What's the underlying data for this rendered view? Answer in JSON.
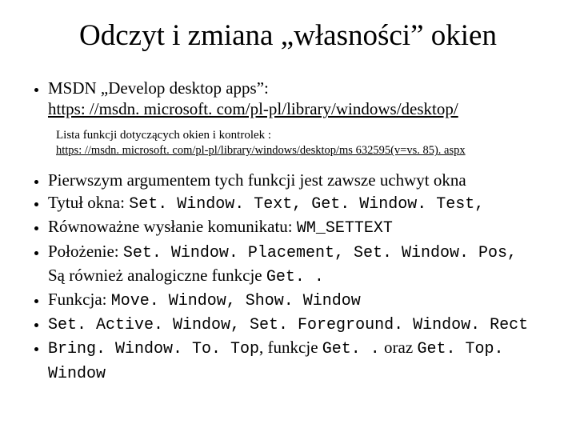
{
  "title": "Odczyt i zmiana „własności” okien",
  "intro": {
    "line1": "MSDN „Develop desktop apps”:",
    "url1": "https: //msdn. microsoft. com/pl-pl/library/windows/desktop/"
  },
  "sub": {
    "line1": "Lista funkcji dotyczących okien i kontrolek :",
    "url1": "https: //msdn. microsoft. com/pl-pl/library/windows/desktop/ms 632595(v=vs. 85). aspx"
  },
  "b1": {
    "t": "Pierwszym argumentem tych funkcji jest zawsze uchwyt okna"
  },
  "b2": {
    "t1": "Tytuł okna: ",
    "c1": "Set. Window. Text, Get. Window. Test,"
  },
  "b3": {
    "t1": "Równoważne wysłanie komunikatu: ",
    "c1": "WM_SETTEXT"
  },
  "b4": {
    "t1": "Położenie: ",
    "c1": "Set. Window. Placement, Set. Window. Pos,",
    "t2": "Są również analogiczne funkcje ",
    "c2": "Get. ."
  },
  "b5": {
    "t1": "Funkcja: ",
    "c1": "Move. Window, Show. Window"
  },
  "b6": {
    "c1": "Set. Active. Window, Set. Foreground. Window. Rect"
  },
  "b7": {
    "c1": "Bring. Window. To. Top",
    "t1": ", funkcje ",
    "c2": "Get. .",
    "t2": " oraz ",
    "c3": "Get. Top. Window"
  }
}
